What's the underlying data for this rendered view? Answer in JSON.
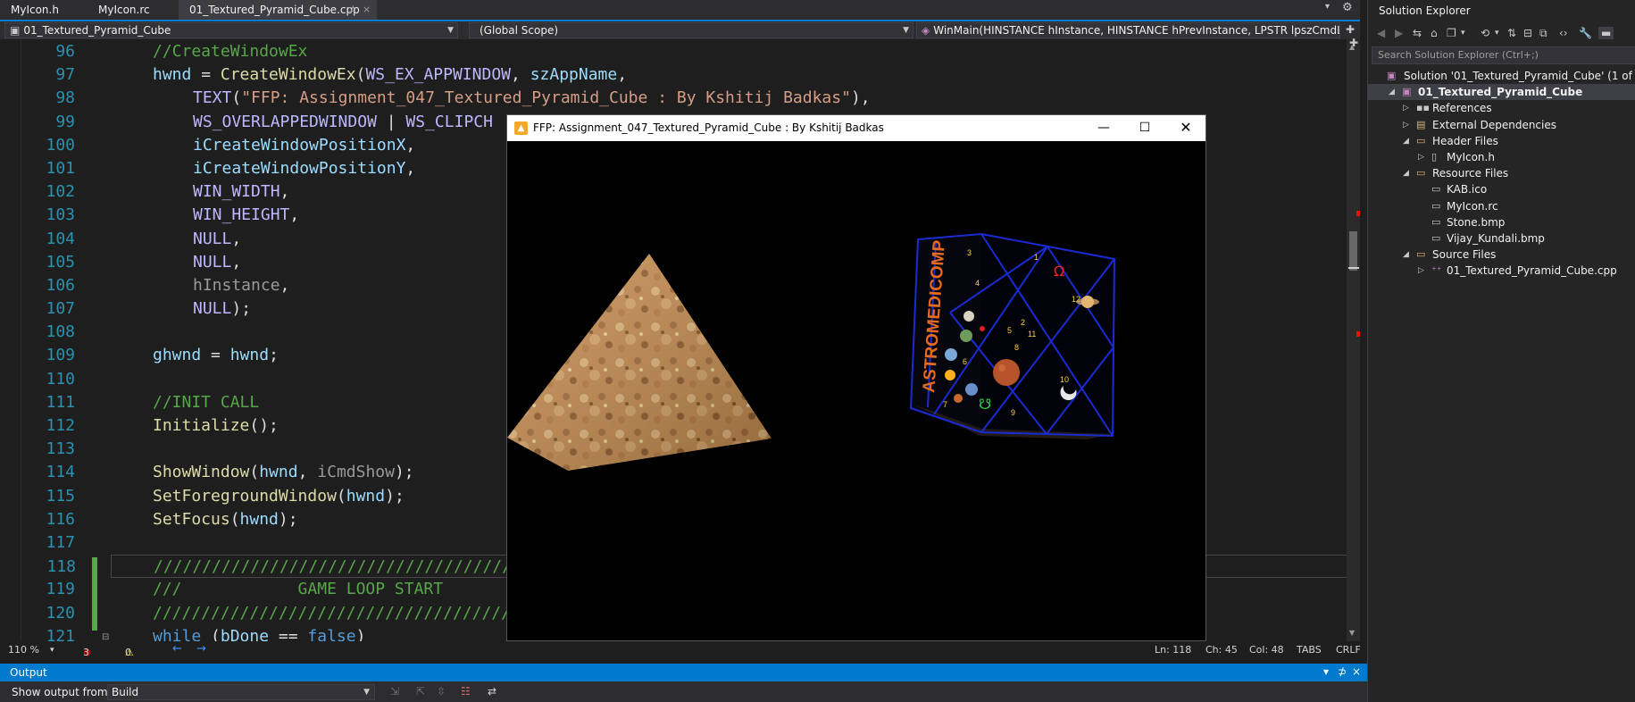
{
  "tabs": [
    {
      "label": "MyIcon.h"
    },
    {
      "label": "MyIcon.rc"
    },
    {
      "label": "01_Textured_Pyramid_Cube.cpp",
      "pin": "⊅",
      "close": "×"
    }
  ],
  "navbar": {
    "project": "01_Textured_Pyramid_Cube",
    "scope": "(Global Scope)",
    "function": "WinMain(HINSTANCE hInstance, HINSTANCE hPrevInstance, LPSTR lpszCmdLine, int iCm"
  },
  "code": {
    "lines": [
      {
        "n": "96"
      },
      {
        "n": "97"
      },
      {
        "n": "98"
      },
      {
        "n": "99"
      },
      {
        "n": "100"
      },
      {
        "n": "101"
      },
      {
        "n": "102"
      },
      {
        "n": "103"
      },
      {
        "n": "104"
      },
      {
        "n": "105"
      },
      {
        "n": "106"
      },
      {
        "n": "107"
      },
      {
        "n": "108"
      },
      {
        "n": "109"
      },
      {
        "n": "110"
      },
      {
        "n": "111"
      },
      {
        "n": "112"
      },
      {
        "n": "113"
      },
      {
        "n": "114"
      },
      {
        "n": "115"
      },
      {
        "n": "116"
      },
      {
        "n": "117"
      },
      {
        "n": "118"
      },
      {
        "n": "119"
      },
      {
        "n": "120"
      },
      {
        "n": "121"
      }
    ],
    "t": {
      "l96": "//CreateWindowEx",
      "l97a": "hwnd",
      "l97b": " = ",
      "l97c": "CreateWindowEx",
      "l97d": "(",
      "l97e": "WS_EX_APPWINDOW",
      "l97f": ", ",
      "l97g": "szAppName",
      "l97h": ",",
      "l98a": "TEXT",
      "l98b": "(",
      "l98c": "\"FFP: Assignment_047_Textured_Pyramid_Cube : By Kshitij Badkas\"",
      "l98d": "),",
      "l99a": "WS_OVERLAPPEDWINDOW",
      "l99b": " | ",
      "l99c": "WS_CLIPCH",
      "l100": "iCreateWindowPositionX",
      "l100c": ",",
      "l101": "iCreateWindowPositionY",
      "l101c": ",",
      "l102": "WIN_WIDTH",
      "l102c": ",",
      "l103": "WIN_HEIGHT",
      "l103c": ",",
      "l104": "NULL",
      "l104c": ",",
      "l105": "NULL",
      "l105c": ",",
      "l106": "hInstance",
      "l106c": ",",
      "l107": "NULL",
      "l107c": ");",
      "l109a": "ghwnd",
      "l109b": " = ",
      "l109c": "hwnd",
      "l109d": ";",
      "l111": "//INIT CALL",
      "l112a": "Initialize",
      "l112b": "();",
      "l114a": "ShowWindow",
      "l114b": "(",
      "l114c": "hwnd",
      "l114d": ", ",
      "l114e": "iCmdShow",
      "l114f": ");",
      "l115a": "SetForegroundWindow",
      "l115b": "(",
      "l115c": "hwnd",
      "l115d": ");",
      "l116a": "SetFocus",
      "l116b": "(",
      "l116c": "hwnd",
      "l116d": ");",
      "l118": "///////////////////////////////////////",
      "l119": "///            GAME LOOP START",
      "l120": "///////////////////////////////////////",
      "l121a": "while",
      "l121b": " (",
      "l121c": "bDone",
      "l121d": " == ",
      "l121e": "false",
      "l121f": ")"
    }
  },
  "editor_status": {
    "zoom": "110 %",
    "errors": "3",
    "warnings": "0",
    "ln": "Ln: 118",
    "ch": "Ch: 45",
    "col": "Col: 48",
    "tabs": "TABS",
    "eol": "CRLF"
  },
  "output": {
    "title": "Output",
    "show_from_label": "Show output from:",
    "source": "Build",
    "pin": "▾",
    "pin2": "⊅",
    "close": "×"
  },
  "solution_explorer": {
    "title": "Solution Explorer",
    "search_placeholder": "Search Solution Explorer (Ctrl+;)",
    "tree": [
      {
        "label": "Solution '01_Textured_Pyramid_Cube' (1 of 1 project)",
        "icon": "solution-icon"
      },
      {
        "label": "01_Textured_Pyramid_Cube",
        "icon": "project-icon"
      },
      {
        "label": "References",
        "icon": "references-icon"
      },
      {
        "label": "External Dependencies",
        "icon": "dependencies-icon"
      },
      {
        "label": "Header Files",
        "icon": "folder-icon"
      },
      {
        "label": "MyIcon.h",
        "icon": "file-icon"
      },
      {
        "label": "Resource Files",
        "icon": "folder-icon"
      },
      {
        "label": "KAB.ico",
        "icon": "file-icon"
      },
      {
        "label": "MyIcon.rc",
        "icon": "file-icon"
      },
      {
        "label": "Stone.bmp",
        "icon": "file-icon"
      },
      {
        "label": "Vijay_Kundali.bmp",
        "icon": "file-icon"
      },
      {
        "label": "Source Files",
        "icon": "folder-icon"
      },
      {
        "label": "01_Textured_Pyramid_Cube.cpp",
        "icon": "cpp-file-icon"
      }
    ]
  },
  "app_window": {
    "title": "FFP: Assignment_047_Textured_Pyramid_Cube : By Kshitij Badkas",
    "cube_text": "ASTROMEDICOMP",
    "house_numbers": [
      "1",
      "2",
      "3",
      "4",
      "5",
      "6",
      "7",
      "8",
      "9",
      "10",
      "11",
      "12"
    ],
    "glyph_omega": "Ω",
    "glyph_ketu": "☋"
  },
  "colors": {
    "accent": "#007acc",
    "editor_bg": "#1e1e1e",
    "comment": "#57a64a",
    "line_number": "#2b91af",
    "stone": "#c8945a",
    "cube_orange": "#e86a1e",
    "cube_blue": "#1a2bd1"
  }
}
